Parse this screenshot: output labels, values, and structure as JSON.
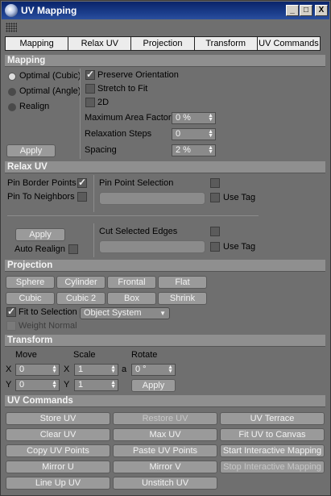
{
  "window": {
    "title": "UV Mapping",
    "min": "_",
    "max": "□",
    "close": "X"
  },
  "tabs": [
    "Mapping",
    "Relax UV",
    "Projection",
    "Transform",
    "UV Commands"
  ],
  "mapping": {
    "header": "Mapping",
    "radios": [
      "Optimal (Cubic)",
      "Optimal (Angle)",
      "Realign"
    ],
    "preserve_orientation": "Preserve Orientation",
    "stretch_to_fit": "Stretch to Fit",
    "two_d": "2D",
    "max_area_label": "Maximum Area Factor",
    "max_area_value": "0 %",
    "relax_steps_label": "Relaxation Steps",
    "relax_steps_value": "0",
    "spacing_label": "Spacing",
    "spacing_value": "2 %",
    "apply": "Apply"
  },
  "relax": {
    "header": "Relax UV",
    "pin_border": "Pin Border Points",
    "pin_neighbors": "Pin To Neighbors",
    "pin_point_selection": "Pin Point Selection",
    "use_tag": "Use Tag",
    "apply": "Apply",
    "auto_realign": "Auto Realign",
    "cut_selected_edges": "Cut Selected Edges",
    "use_tag2": "Use Tag"
  },
  "projection": {
    "header": "Projection",
    "row1": [
      "Sphere",
      "Cylinder",
      "Frontal",
      "Flat"
    ],
    "row2": [
      "Cubic",
      "Cubic 2",
      "Box",
      "Shrink"
    ],
    "fit_to_selection": "Fit to Selection",
    "object_system": "Object System",
    "weight_normal": "Weight Normal"
  },
  "transform": {
    "header": "Transform",
    "move": "Move",
    "scale": "Scale",
    "rotate": "Rotate",
    "x": "X",
    "y": "Y",
    "a": "a",
    "move_x": "0",
    "move_y": "0",
    "scale_x": "1",
    "scale_y": "1",
    "rotate_a": "0 °",
    "apply": "Apply"
  },
  "uv_commands": {
    "header": "UV Commands",
    "rows": [
      [
        "Store UV",
        "Restore UV",
        "UV Terrace"
      ],
      [
        "Clear UV",
        "Max UV",
        "Fit UV to Canvas"
      ],
      [
        "Copy UV Points",
        "Paste UV Points",
        "Start Interactive Mapping"
      ],
      [
        "Mirror U",
        "Mirror V",
        "Stop Interactive Mapping"
      ],
      [
        "Line Up UV",
        "Unstitch UV"
      ]
    ]
  },
  "colors": {
    "title_bar": "#0a246a",
    "panel": "#6f6f6f",
    "section": "#8f8f8f",
    "button": "#9a9a9a"
  }
}
